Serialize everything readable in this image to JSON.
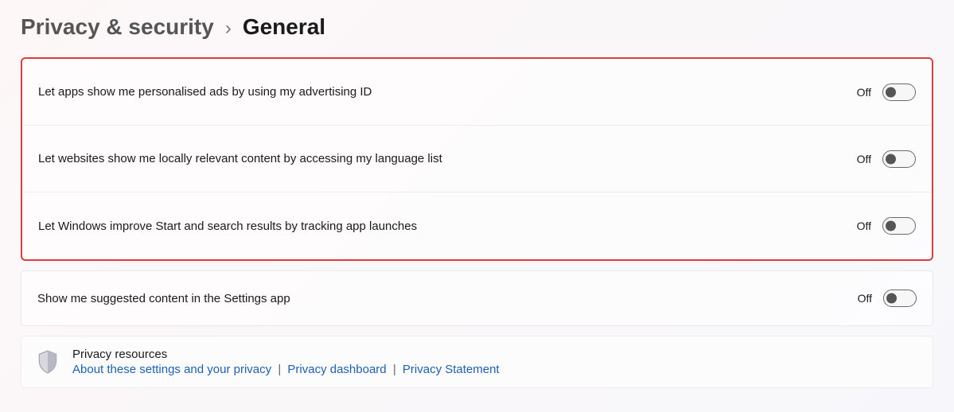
{
  "breadcrumb": {
    "parent": "Privacy & security",
    "separator": "›",
    "current": "General"
  },
  "settings": [
    {
      "label": "Let apps show me personalised ads by using my advertising ID",
      "state": "Off"
    },
    {
      "label": "Let websites show me locally relevant content by accessing my language list",
      "state": "Off"
    },
    {
      "label": "Let Windows improve Start and search results by tracking app launches",
      "state": "Off"
    },
    {
      "label": "Show me suggested content in the Settings app",
      "state": "Off"
    }
  ],
  "resources": {
    "title": "Privacy resources",
    "links": [
      "About these settings and your privacy",
      "Privacy dashboard",
      "Privacy Statement"
    ],
    "separator": "|"
  }
}
